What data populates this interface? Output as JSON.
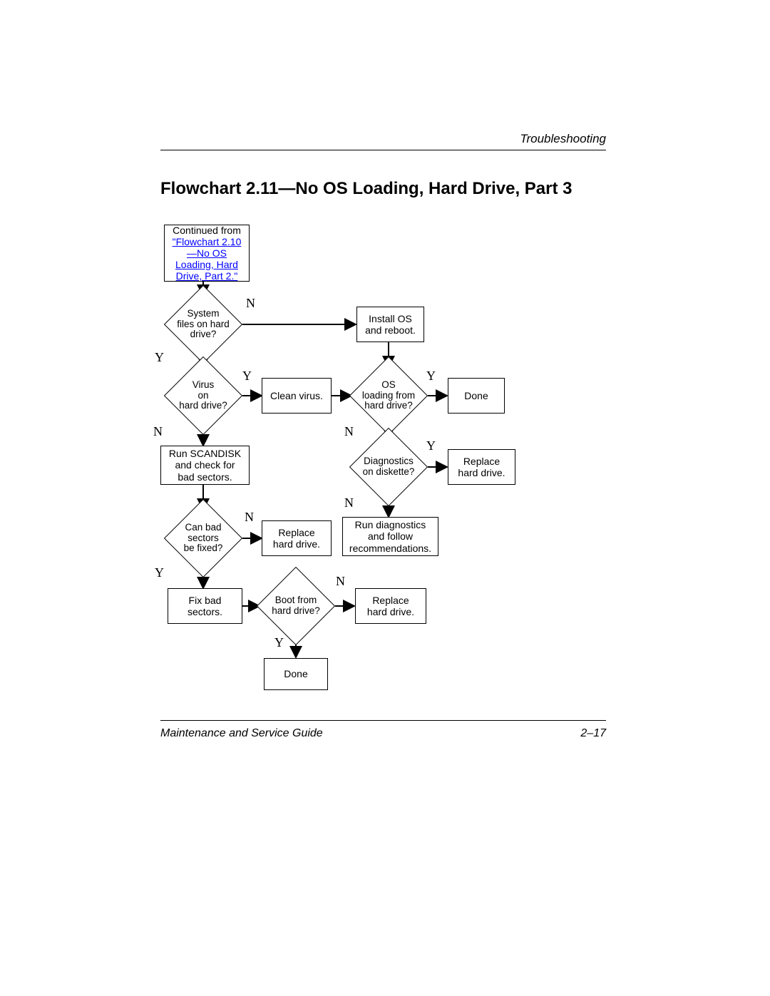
{
  "header": {
    "section": "Troubleshooting"
  },
  "title": "Flowchart 2.11—No OS Loading, Hard Drive, Part 3",
  "footer": {
    "left": "Maintenance and Service Guide",
    "right": "2–17"
  },
  "nodes": {
    "origin_prefix": "Continued from ",
    "origin_link": "\"Flowchart 2.10—No OS Loading, Hard Drive, Part 2.\"",
    "d_sysfiles": "System\nfiles on hard\ndrive?",
    "b_install": "Install OS\nand reboot.",
    "d_virus": "Virus\non\nhard drive?",
    "b_cleanvirus": "Clean virus.",
    "d_osload": "OS\nloading from\nhard drive?",
    "b_done1": "Done",
    "b_scandisk": "Run SCANDISK\nand check for\nbad sectors.",
    "d_diagdisk": "Diagnostics\non diskette?",
    "b_replace1": "Replace\nhard drive.",
    "d_badfix": "Can bad\nsectors\nbe fixed?",
    "b_replace2": "Replace\nhard drive.",
    "b_rundiag": "Run diagnostics\nand follow\nrecommendations.",
    "b_fixbad": "Fix bad\nsectors.",
    "d_boot": "Boot from\nhard drive?",
    "b_replace3": "Replace\nhard drive.",
    "b_done2": "Done"
  },
  "edges": {
    "Y": "Y",
    "N": "N"
  }
}
